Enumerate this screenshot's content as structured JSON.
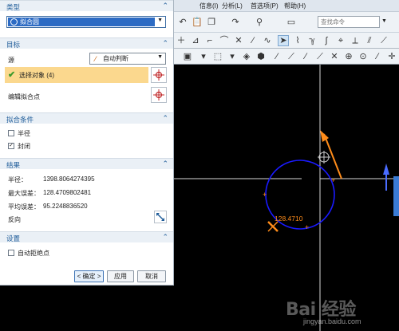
{
  "menubar": {
    "items": [
      "信息(I)",
      "分析(L)",
      "首选项(P)",
      "帮助(H)"
    ]
  },
  "toolbar": {
    "search_placeholder": "查找命令"
  },
  "dialog": {
    "type": {
      "header": "类型",
      "value": "拟合圆"
    },
    "target": {
      "header": "目标",
      "source_label": "源",
      "source_value": "自动判断",
      "select_label": "选择对象 (4)",
      "edit_label": "编辑拟合点"
    },
    "conditions": {
      "header": "拟合条件",
      "radius_label": "半径",
      "radius_checked": false,
      "closed_label": "封闭",
      "closed_checked": true
    },
    "results": {
      "header": "结果",
      "radius_label": "半径：",
      "radius_value": "1398.8064274395",
      "max_err_label": "最大误差：",
      "max_err_value": "128.4709802481",
      "avg_err_label": "平均误差：",
      "avg_err_value": "95.2248836520",
      "reverse_label": "反向"
    },
    "settings": {
      "header": "设置",
      "auto_reject_label": "自动拒绝点",
      "auto_reject_checked": false
    },
    "buttons": {
      "ok": "< 确定 >",
      "apply": "应用",
      "cancel": "取消"
    }
  },
  "canvas": {
    "annotation": "128.4710",
    "circle_color": "#1a1aff",
    "accent_color": "#ff8c1a"
  },
  "watermark": {
    "main": "Bai 经验",
    "url": "jingyan.baidu.com"
  }
}
